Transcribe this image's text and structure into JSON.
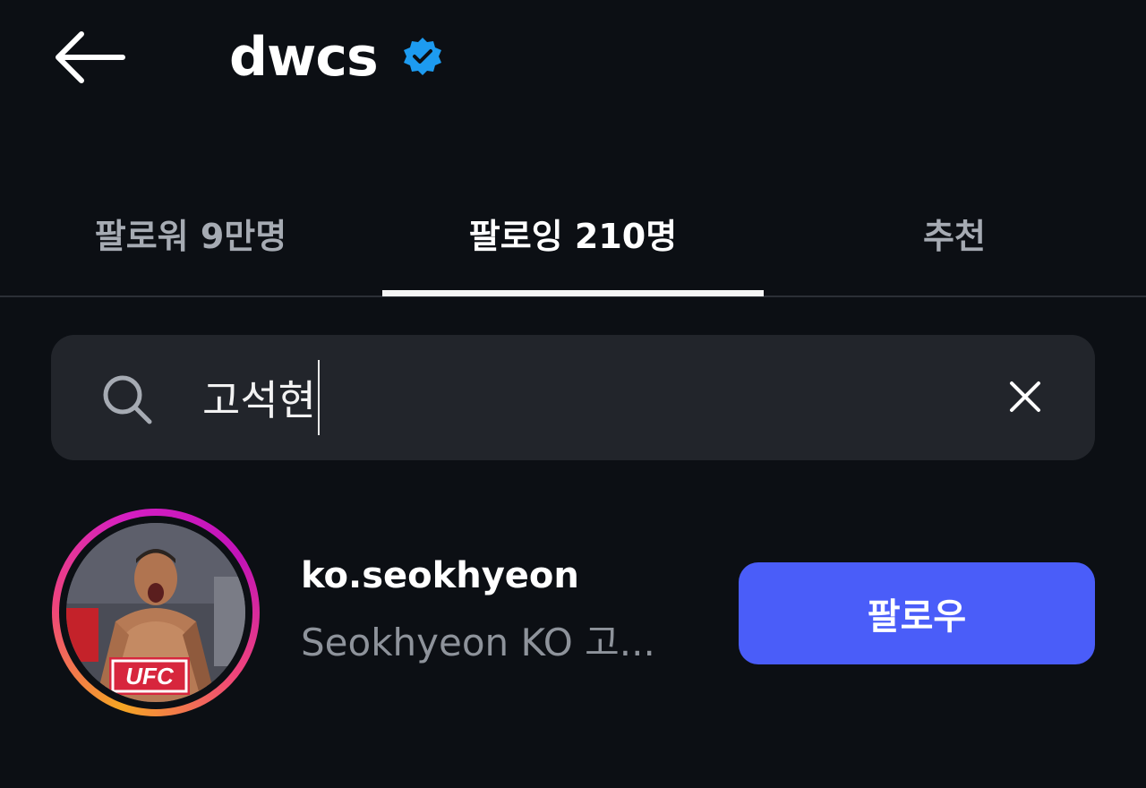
{
  "header": {
    "title": "dwcs",
    "verified": true,
    "back_icon": "arrow-left-icon",
    "verified_icon": "verified-badge-icon"
  },
  "tabs": [
    {
      "label": "팔로워 9만명",
      "active": false
    },
    {
      "label": "팔로잉 210명",
      "active": true
    },
    {
      "label": "추천",
      "active": false
    }
  ],
  "search": {
    "value": "고석현",
    "icon": "search-icon",
    "clear_icon": "close-icon"
  },
  "results": [
    {
      "username": "ko.seokhyeon",
      "full_name": "Seokhyeon KO 고...",
      "follow_label": "팔로우",
      "avatar_badge": "UFC"
    }
  ],
  "colors": {
    "background": "#0c0f14",
    "search_bg": "#22252b",
    "follow_button": "#4a5df9",
    "verified": "#1d9bf0",
    "inactive_tab": "#a6abb3"
  }
}
